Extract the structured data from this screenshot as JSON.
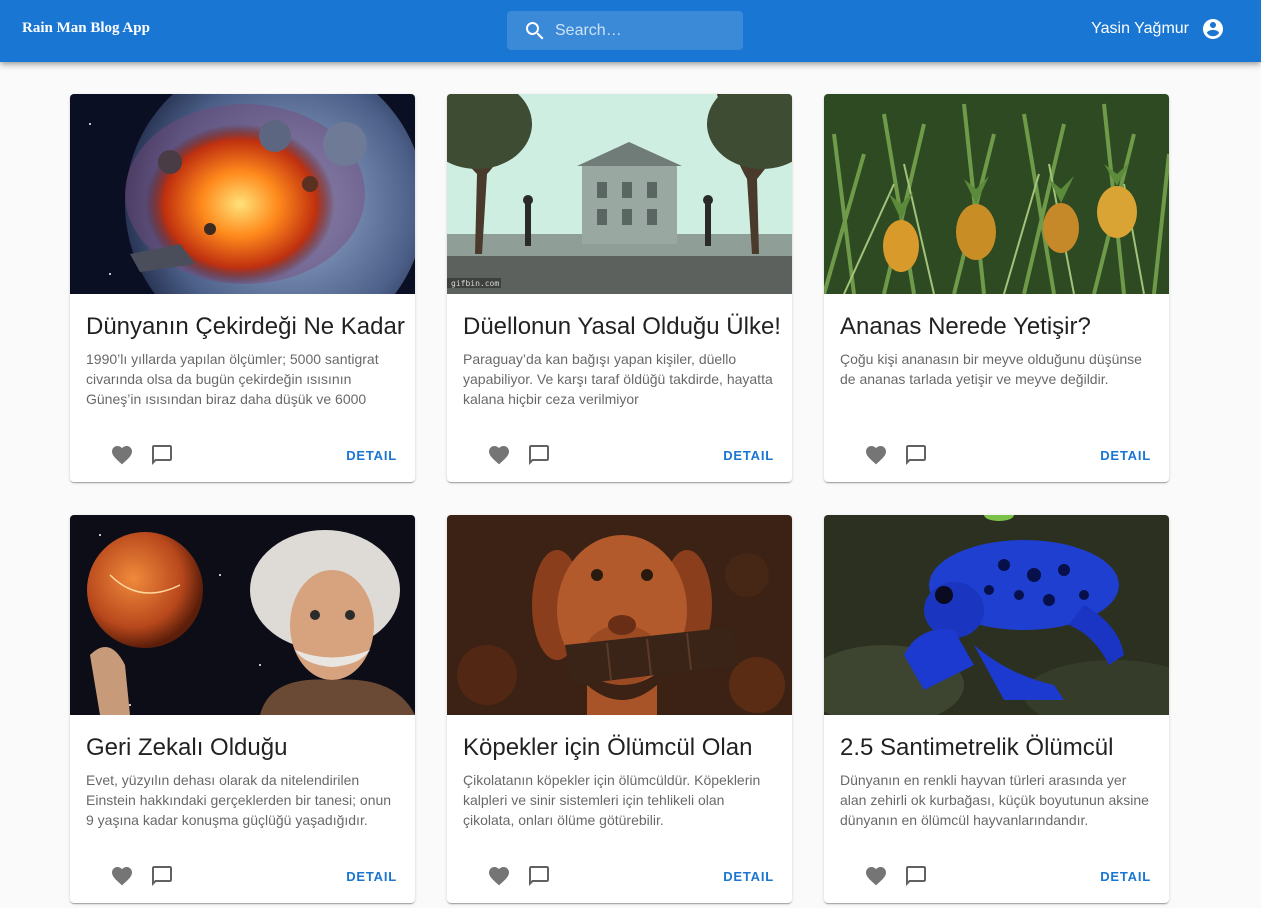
{
  "app": {
    "title": "Rain Man Blog App"
  },
  "search": {
    "placeholder": "Search…",
    "icon": "search-icon"
  },
  "user": {
    "name": "Yasin Yağmur",
    "icon": "account-circle-icon"
  },
  "colors": {
    "primary": "#1976d2",
    "background": "#fafafa",
    "icon_gray": "#757575"
  },
  "cards": [
    {
      "title": "Dünyanın Çekirdeği Ne Kadar",
      "description": "1990’lı yıllarda yapılan ölçümler; 5000 santigrat civarında olsa da bugün çekirdeğin ısısının Güneş’in ısısından biraz daha düşük ve 6000",
      "detail_label": "DETAIL"
    },
    {
      "title": "Düellonun Yasal Olduğu Ülke!",
      "description": "Paraguay’da kan bağışı yapan kişiler, düello yapabiliyor. Ve karşı taraf öldüğü takdirde, hayatta kalana hiçbir ceza verilmiyor",
      "detail_label": "DETAIL",
      "image_caption": "gifbin.com"
    },
    {
      "title": "Ananas Nerede Yetişir?",
      "description": "Çoğu kişi ananasın bir meyve olduğunu düşünse de ananas tarlada yetişir ve meyve değildir.",
      "detail_label": "DETAIL"
    },
    {
      "title": "Geri Zekalı Olduğu",
      "description": "Evet, yüzyılın dehası olarak da nitelendirilen Einstein hakkındaki gerçeklerden bir tanesi; onun 9 yaşına kadar konuşma güçlüğü yaşadığıdır.",
      "detail_label": "DETAIL"
    },
    {
      "title": "Köpekler için Ölümcül Olan",
      "description": "Çikolatanın köpekler için ölümcüldür. Köpeklerin kalpleri ve sinir sistemleri için tehlikeli olan çikolata, onları ölüme götürebilir.",
      "detail_label": "DETAIL"
    },
    {
      "title": "2.5 Santimetrelik Ölümcül",
      "description": "Dünyanın en renkli hayvan türleri arasında yer alan zehirli ok kurbağası, küçük boyutunun aksine dünyanın en ölümcül hayvanlarındandır.",
      "detail_label": "DETAIL"
    }
  ]
}
